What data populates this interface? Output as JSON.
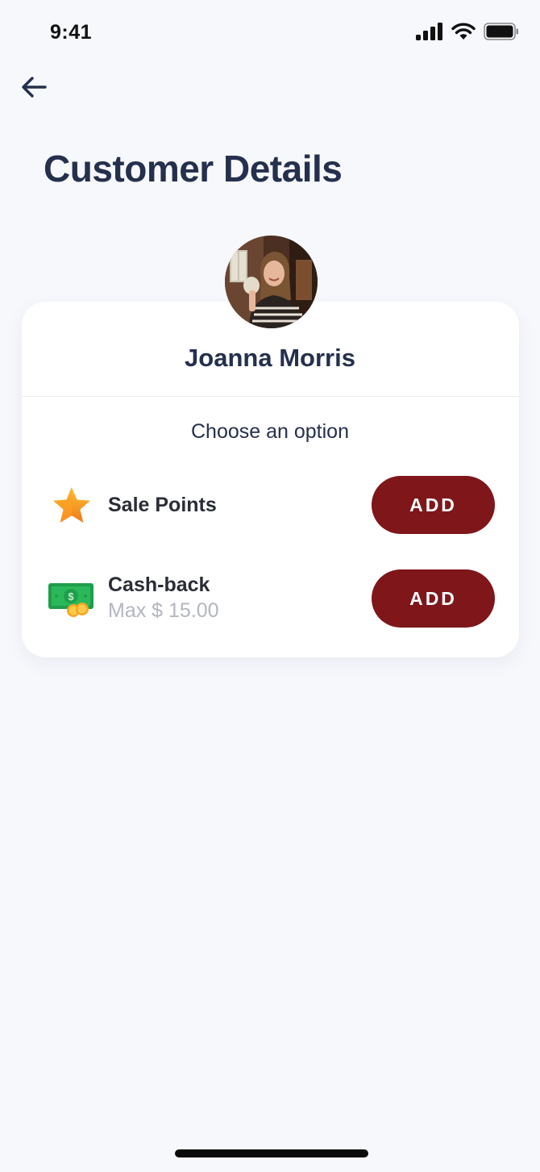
{
  "status_bar": {
    "time": "9:41",
    "icons": [
      "cellular-signal-icon",
      "wifi-icon",
      "battery-icon"
    ]
  },
  "header": {
    "back_icon": "arrow-left-icon",
    "title": "Customer Details"
  },
  "customer": {
    "name": "Joanna Morris",
    "avatar": "avatar-photo"
  },
  "options": {
    "prompt": "Choose an option",
    "items": [
      {
        "icon": "star-icon",
        "title": "Sale Points",
        "subtitle": "",
        "button_label": "ADD"
      },
      {
        "icon": "cash-money-icon",
        "title": "Cash-back",
        "subtitle": "Max $ 15.00",
        "button_label": "ADD"
      }
    ]
  },
  "colors": {
    "background": "#f7f8fc",
    "card": "#ffffff",
    "title_text": "#25304d",
    "button_bg": "#7e161a",
    "button_text": "#ffffff",
    "subtitle_text": "#b3b6bf"
  }
}
